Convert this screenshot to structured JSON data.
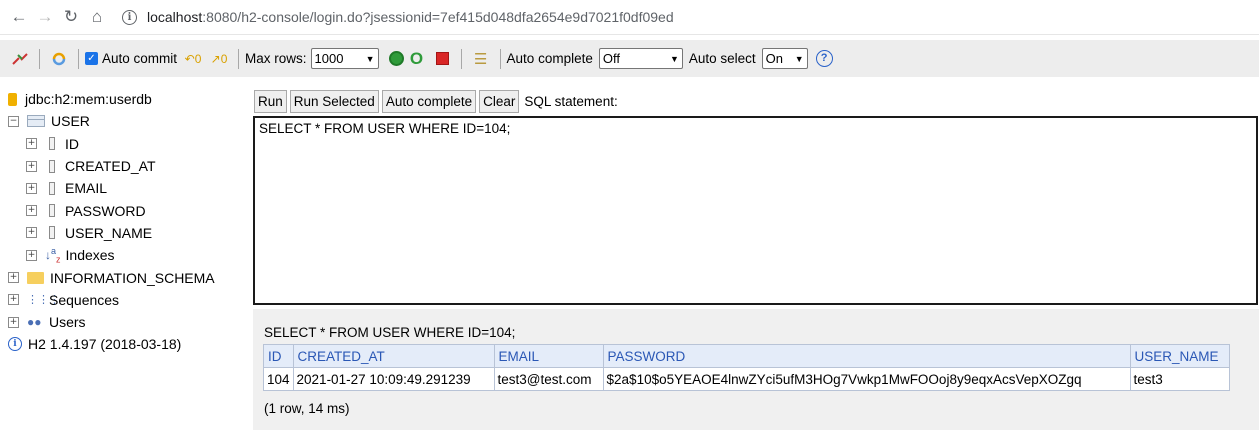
{
  "browser": {
    "url_host": "localhost",
    "url_path": ":8080/h2-console/login.do?jsessionid=7ef415d048dfa2654e9d7021f0df09ed"
  },
  "toolbar": {
    "auto_commit_label": "Auto commit",
    "max_rows_label": "Max rows:",
    "max_rows_value": "1000",
    "auto_complete_label": "Auto complete",
    "auto_complete_value": "Off",
    "auto_select_label": "Auto select",
    "auto_select_value": "On"
  },
  "tree": {
    "connection": "jdbc:h2:mem:userdb",
    "table": "USER",
    "columns": [
      "ID",
      "CREATED_AT",
      "EMAIL",
      "PASSWORD",
      "USER_NAME"
    ],
    "indexes": "Indexes",
    "schema": "INFORMATION_SCHEMA",
    "sequences": "Sequences",
    "users": "Users",
    "version": "H2 1.4.197 (2018-03-18)"
  },
  "query_bar": {
    "run": "Run",
    "run_selected": "Run Selected",
    "auto_complete": "Auto complete",
    "clear": "Clear",
    "sql_label": "SQL statement:"
  },
  "editor": {
    "sql": "SELECT * FROM USER WHERE ID=104;"
  },
  "results": {
    "sql": "SELECT * FROM USER WHERE ID=104;",
    "headers": [
      "ID",
      "CREATED_AT",
      "EMAIL",
      "PASSWORD",
      "USER_NAME"
    ],
    "rows": [
      [
        "104",
        "2021-01-27 10:09:49.291239",
        "test3@test.com",
        "$2a$10$o5YEAOE4lnwZYci5ufM3HOg7Vwkp1MwFOOoj8y9eqxAcsVepXOZgq",
        "test3"
      ]
    ],
    "status": "(1 row, 14 ms)"
  }
}
